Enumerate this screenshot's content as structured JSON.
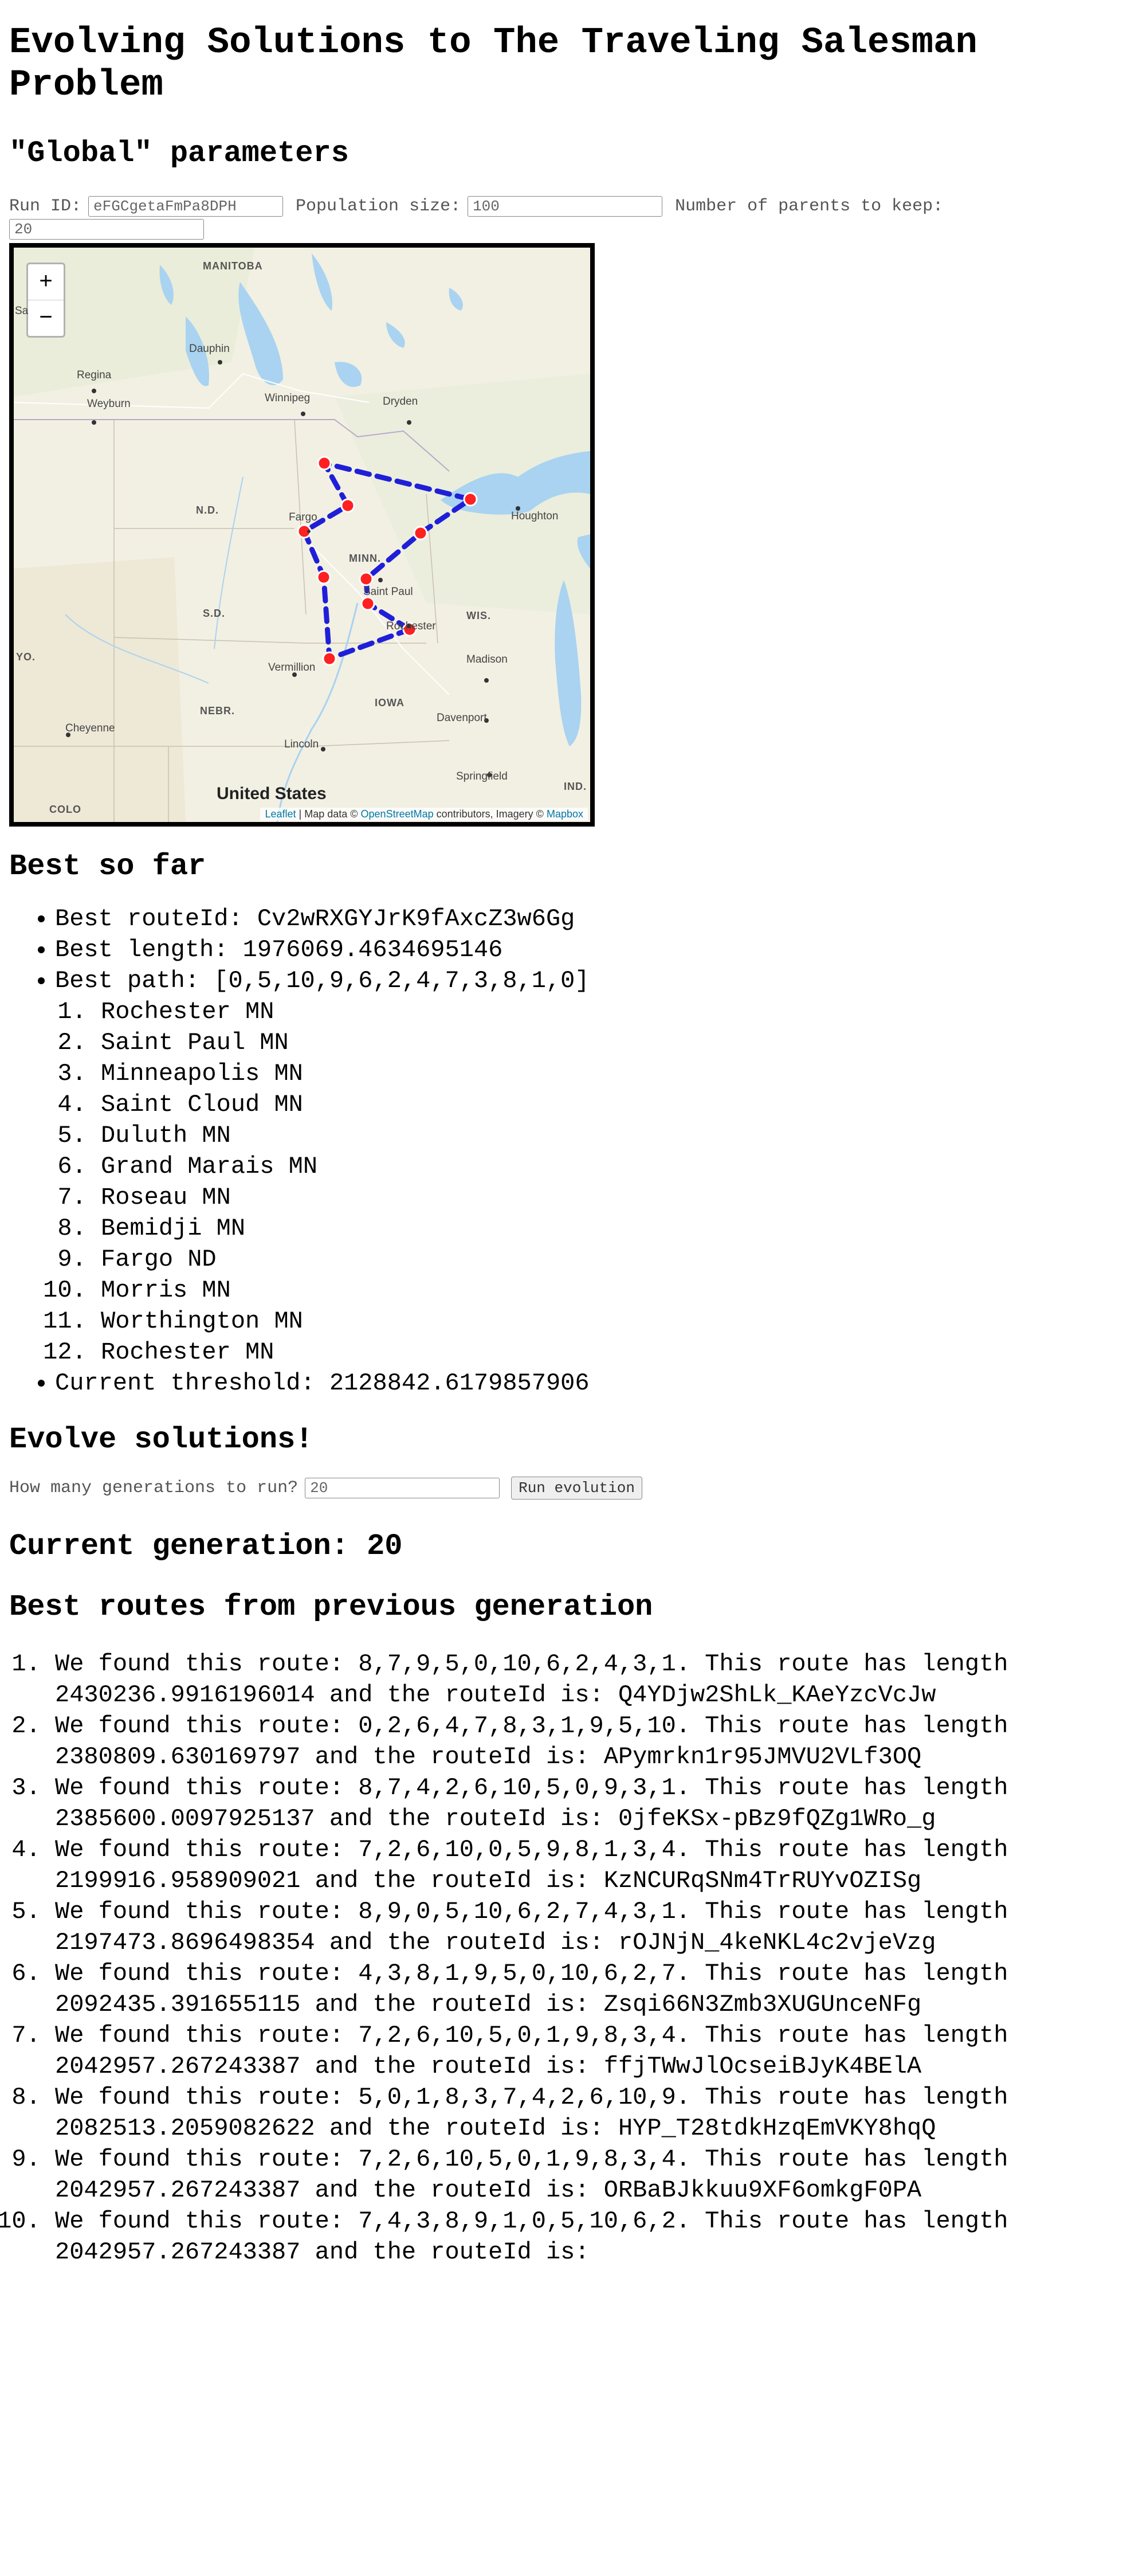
{
  "title": "Evolving Solutions to The Traveling Salesman Problem",
  "global": {
    "heading": "\"Global\" parameters",
    "run_id_label": "Run ID:",
    "run_id_value": "eFGCgetaFmPa8DPH",
    "population_label": "Population size:",
    "population_value": "100",
    "parents_label": "Number of parents to keep:",
    "parents_value": "20"
  },
  "map": {
    "zoom_in": "+",
    "zoom_out": "−",
    "attribution_leaflet": "Leaflet",
    "attribution_text": " | Map data © ",
    "attribution_osm": "OpenStreetMap",
    "attribution_text2": " contributors, Imagery © ",
    "attribution_mapbox": "Mapbox",
    "labels": {
      "manitoba": "MANITOBA",
      "sa": "Sa",
      "dauphin": "Dauphin",
      "regina": "Regina",
      "weyburn": "Weyburn",
      "winnipeg": "Winnipeg",
      "dryden": "Dryden",
      "nd": "N.D.",
      "fargo": "Fargo",
      "minn": "MINN.",
      "houghton": "Houghton",
      "sd": "S.D.",
      "saint_paul": "Saint Paul",
      "rochester": "Rochester",
      "wis": "WIS.",
      "yo": "YO.",
      "vermillion": "Vermillion",
      "madison": "Madison",
      "nebr": "NEBR.",
      "iowa": "IOWA",
      "davenport": "Davenport",
      "cheyenne": "Cheyenne",
      "lincoln": "Lincoln",
      "springfield": "Springfield",
      "united_states": "United States",
      "colo": "COLO",
      "ind": "IND."
    },
    "colors": {
      "route": "#1f1fd8",
      "marker": "#ff2020",
      "water": "#a9d3f0"
    }
  },
  "best": {
    "heading": "Best so far",
    "route_id": "Best routeId: Cv2wRXGYJrK9fAxcZ3w6Gg",
    "length": "Best length: 1976069.4634695146",
    "path": "Best path: [0,5,10,9,6,2,4,7,3,8,1,0]",
    "cities": [
      "Rochester MN",
      "Saint Paul MN",
      "Minneapolis MN",
      "Saint Cloud MN",
      "Duluth MN",
      "Grand Marais MN",
      "Roseau MN",
      "Bemidji MN",
      "Fargo ND",
      "Morris MN",
      "Worthington MN",
      "Rochester MN"
    ],
    "threshold": "Current threshold: 2128842.6179857906"
  },
  "evolve": {
    "heading": "Evolve solutions!",
    "generations_label": "How many generations to run?",
    "generations_value": "20",
    "run_button": "Run evolution"
  },
  "generation": {
    "heading": "Current generation: 20"
  },
  "routes": {
    "heading": "Best routes from previous generation",
    "items": [
      "We found this route: 8,7,9,5,0,10,6,2,4,3,1. This route has length 2430236.9916196014 and the routeId is: Q4YDjw2ShLk_KAeYzcVcJw",
      "We found this route: 0,2,6,4,7,8,3,1,9,5,10. This route has length 2380809.630169797 and the routeId is: APymrkn1r95JMVU2VLf3OQ",
      "We found this route: 8,7,4,2,6,10,5,0,9,3,1. This route has length 2385600.0097925137 and the routeId is: 0jfeKSx-pBz9fQZg1WRo_g",
      "We found this route: 7,2,6,10,0,5,9,8,1,3,4. This route has length 2199916.958909021 and the routeId is: KzNCURqSNm4TrRUYvOZISg",
      "We found this route: 8,9,0,5,10,6,2,7,4,3,1. This route has length 2197473.8696498354 and the routeId is: rOJNjN_4keNKL4c2vjeVzg",
      "We found this route: 4,3,8,1,9,5,0,10,6,2,7. This route has length 2092435.391655115 and the routeId is: Zsqi66N3Zmb3XUGUnceNFg",
      "We found this route: 7,2,6,10,5,0,1,9,8,3,4. This route has length 2042957.267243387 and the routeId is: ffjTWwJlOcseiBJyK4BElA",
      "We found this route: 5,0,1,8,3,7,4,2,6,10,9. This route has length 2082513.2059082622 and the routeId is: HYP_T28tdkHzqEmVKY8hqQ",
      "We found this route: 7,2,6,10,5,0,1,9,8,3,4. This route has length 2042957.267243387 and the routeId is: ORBaBJkkuu9XF6omkgF0PA",
      "We found this route: 7,4,3,8,9,1,0,5,10,6,2. This route has length 2042957.267243387 and the routeId is:"
    ]
  }
}
